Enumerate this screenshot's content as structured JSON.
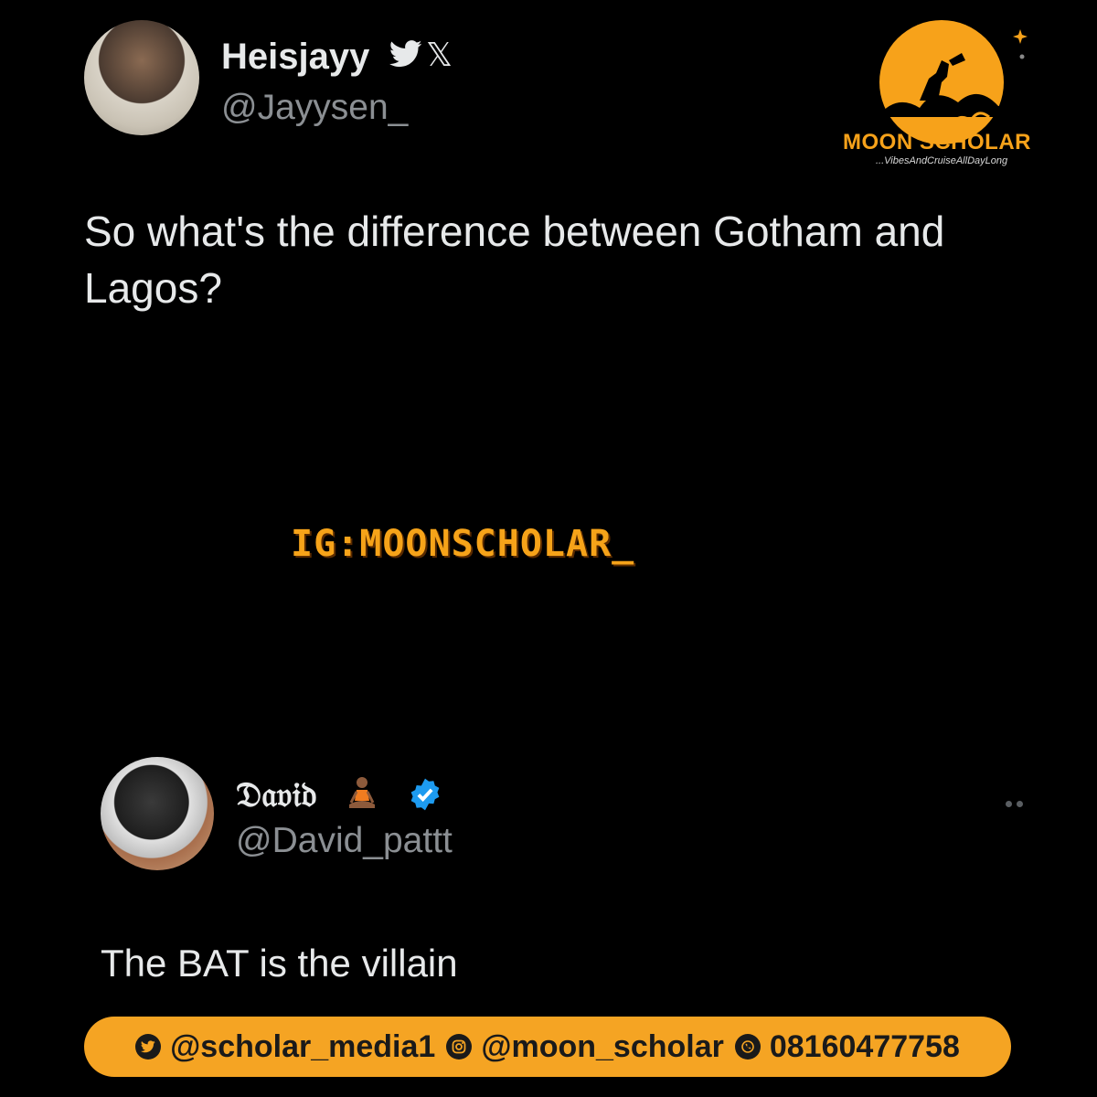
{
  "tweet1": {
    "display_name": "Heisjayy",
    "handle": "@Jayysen_",
    "text": "So what's the difference between Gotham and Lagos?"
  },
  "watermark": "IG:MOONSCHOLAR_",
  "tweet2": {
    "display_name": "𝔇𝔞𝔳𝔦𝔡",
    "handle": "@David_pattt",
    "text": "The BAT is the villain"
  },
  "logo": {
    "title": "MOON SCHOLAR",
    "tagline": "...VibesAndCruiseAllDayLong"
  },
  "footer": {
    "twitter": "@scholar_media1",
    "instagram": "@moon_scholar",
    "whatsapp": "08160477758"
  },
  "colors": {
    "accent": "#f5a423",
    "background": "#000000",
    "muted": "#8b8f93",
    "verified": "#1d9bf0"
  },
  "icons": [
    "bird-icon",
    "x-icon",
    "meditate-icon",
    "verified-icon",
    "more-icon",
    "twitter-icon",
    "instagram-icon",
    "whatsapp-icon"
  ]
}
